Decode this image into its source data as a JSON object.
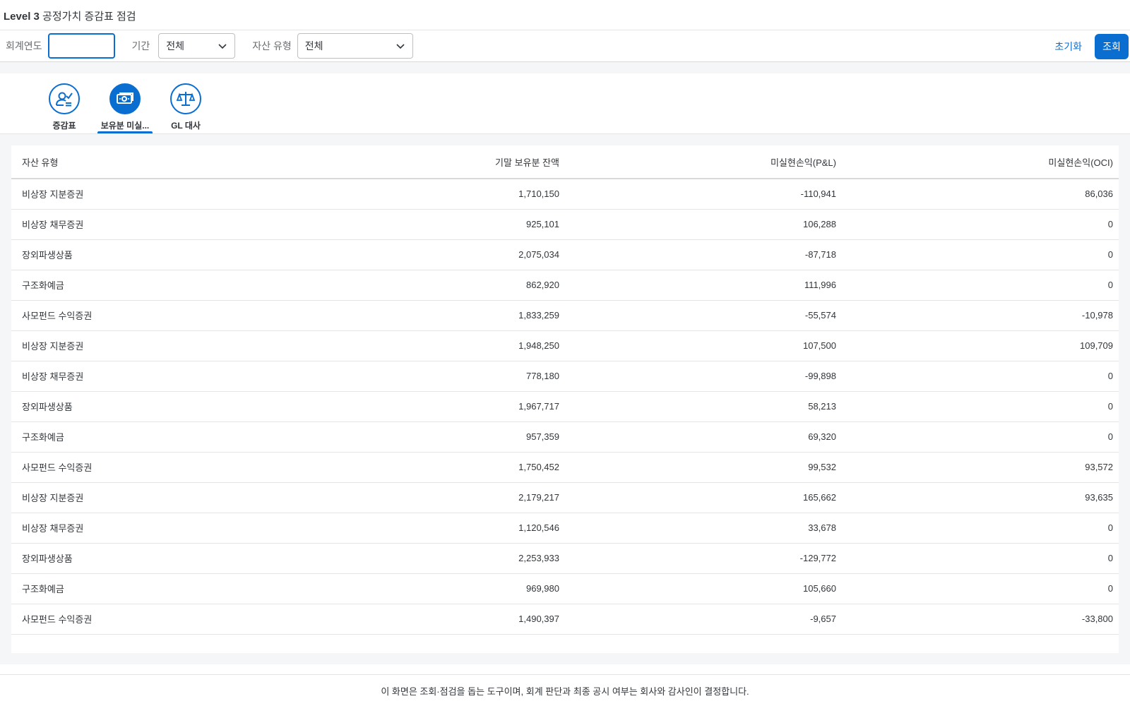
{
  "page": {
    "title_bold": "Level 3",
    "title_rest": " 공정가치 증감표 점검"
  },
  "filters": {
    "year_label": "회계연도",
    "year_value": "",
    "period_label": "기간",
    "period_value": "전체",
    "asset_label": "자산 유형",
    "asset_value": "전체",
    "reset_label": "초기화",
    "search_label": "조회"
  },
  "tabs": [
    {
      "label": "증감표",
      "icon": "user-check-icon",
      "active": false
    },
    {
      "label": "보유분 미실...",
      "icon": "cash-icon",
      "active": true
    },
    {
      "label": "GL 대사",
      "icon": "scale-icon",
      "active": false
    }
  ],
  "table": {
    "headers": [
      "자산 유형",
      "기말 보유분 잔액",
      "미실현손익(P&L)",
      "미실현손익(OCI)"
    ],
    "rows": [
      [
        "비상장 지분증권",
        "1,710,150",
        "-110,941",
        "86,036"
      ],
      [
        "비상장 채무증권",
        "925,101",
        "106,288",
        "0"
      ],
      [
        "장외파생상품",
        "2,075,034",
        "-87,718",
        "0"
      ],
      [
        "구조화예금",
        "862,920",
        "111,996",
        "0"
      ],
      [
        "사모펀드 수익증권",
        "1,833,259",
        "-55,574",
        "-10,978"
      ],
      [
        "비상장 지분증권",
        "1,948,250",
        "107,500",
        "109,709"
      ],
      [
        "비상장 채무증권",
        "778,180",
        "-99,898",
        "0"
      ],
      [
        "장외파생상품",
        "1,967,717",
        "58,213",
        "0"
      ],
      [
        "구조화예금",
        "957,359",
        "69,320",
        "0"
      ],
      [
        "사모펀드 수익증권",
        "1,750,452",
        "99,532",
        "93,572"
      ],
      [
        "비상장 지분증권",
        "2,179,217",
        "165,662",
        "93,635"
      ],
      [
        "비상장 채무증권",
        "1,120,546",
        "33,678",
        "0"
      ],
      [
        "장외파생상품",
        "2,253,933",
        "-129,772",
        "0"
      ],
      [
        "구조화예금",
        "969,980",
        "105,660",
        "0"
      ],
      [
        "사모펀드 수익증권",
        "1,490,397",
        "-9,657",
        "-33,800"
      ]
    ]
  },
  "footer": {
    "disclaimer": "이 화면은 조회·점검을 돕는 도구이며, 회계 판단과 최종 공시 여부는 회사와 감사인이 결정합니다."
  },
  "colors": {
    "accent": "#0a6ed1",
    "text": "#32363a",
    "background": "#f5f6f7"
  }
}
